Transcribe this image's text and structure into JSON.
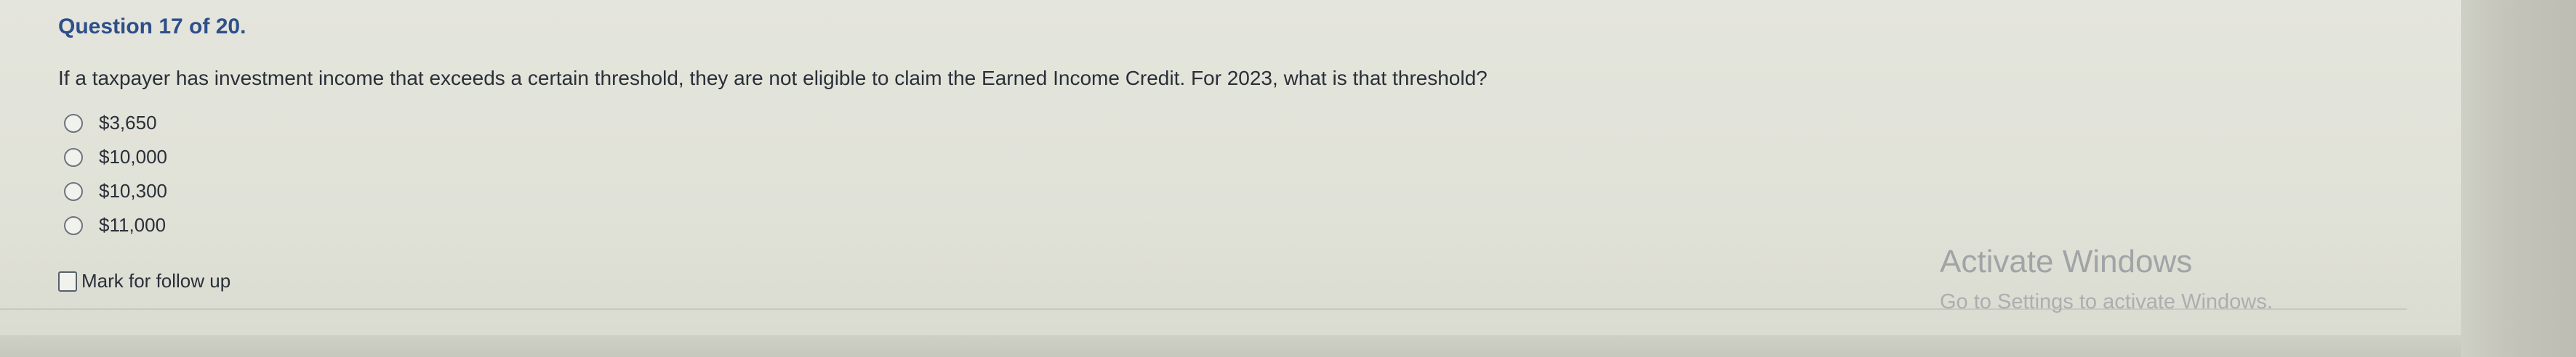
{
  "question": {
    "header": "Question 17 of 20.",
    "text": "If a taxpayer has investment income that exceeds a certain threshold, they are not eligible to claim the Earned Income Credit. For 2023, what is that threshold?",
    "options": [
      {
        "label": "$3,650"
      },
      {
        "label": "$10,000"
      },
      {
        "label": "$10,300"
      },
      {
        "label": "$11,000"
      }
    ]
  },
  "follow_up": {
    "label": "Mark for follow up"
  },
  "watermark": {
    "title": "Activate Windows",
    "subtitle": "Go to Settings to activate Windows."
  },
  "colors": {
    "header_text": "#2d4f8a",
    "body_text": "#2a2f38",
    "background": "#e0e1d7"
  }
}
